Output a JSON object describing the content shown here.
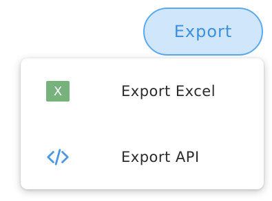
{
  "export_button": {
    "label": "Export"
  },
  "menu": {
    "items": [
      {
        "icon": "excel-icon",
        "icon_text": "X",
        "label": "Export Excel"
      },
      {
        "icon": "code-icon",
        "label": "Export API"
      }
    ]
  },
  "colors": {
    "button_bg": "#cfe6fb",
    "button_border": "#5aa9ee",
    "button_text": "#3d8fe0",
    "excel_green": "#77b27c",
    "code_blue": "#4a98e2"
  }
}
